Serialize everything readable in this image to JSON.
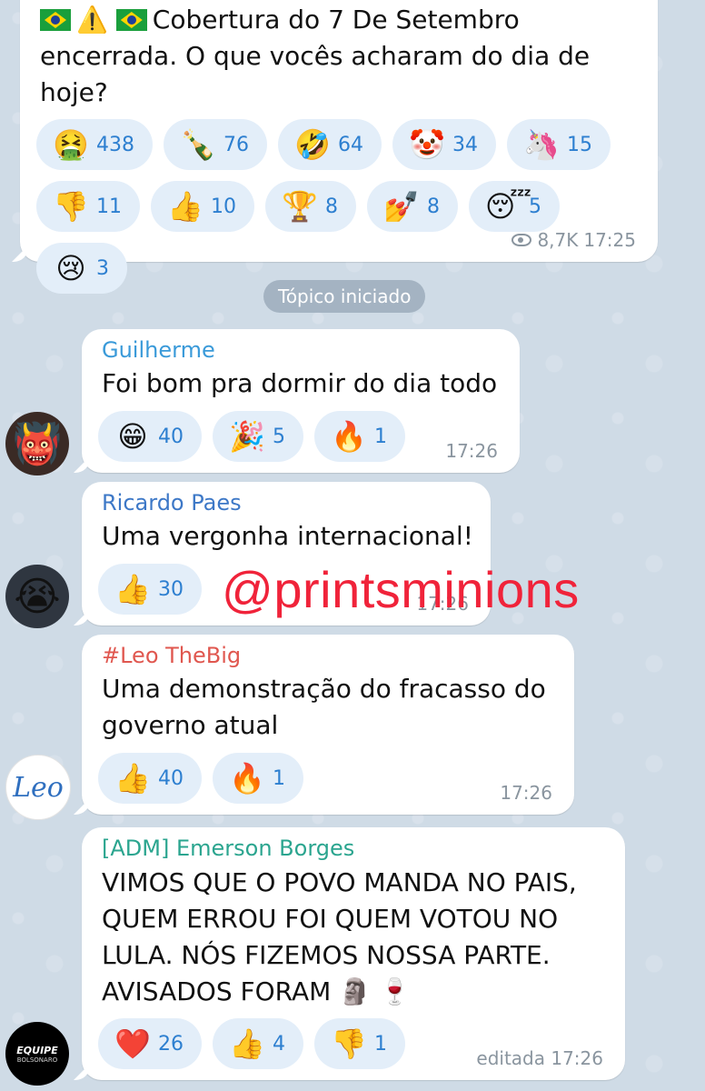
{
  "channel_post": {
    "flag1": "🇧🇷",
    "warning": "⚠️",
    "flag2": "🇧🇷",
    "text_line1": "Cobertura do 7 De Setembro",
    "text_line2": "encerrada. O que vocês acharam do dia de",
    "text_line3": "hoje?",
    "reactions": [
      {
        "emoji": "🤮",
        "count": "438"
      },
      {
        "emoji": "🍾",
        "count": "76"
      },
      {
        "emoji": "🤣",
        "count": "64"
      },
      {
        "emoji": "🤡",
        "count": "34"
      },
      {
        "emoji": "🦄",
        "count": "15"
      },
      {
        "emoji": "👎",
        "count": "11"
      },
      {
        "emoji": "👍",
        "count": "10"
      },
      {
        "emoji": "🏆",
        "count": "8"
      },
      {
        "emoji": "💅",
        "count": "8"
      },
      {
        "emoji": "😴",
        "count": "5"
      },
      {
        "emoji": "😢",
        "count": "3"
      }
    ],
    "views": "8,7K",
    "time": "17:25"
  },
  "service_message": "Tópico iniciado",
  "messages": [
    {
      "sender": "Guilherme",
      "sender_color": "#3a9ad9",
      "text": "Foi bom pra dormir do dia todo",
      "reactions": [
        {
          "emoji": "😁",
          "count": "40"
        },
        {
          "emoji": "🎉",
          "count": "5"
        },
        {
          "emoji": "🔥",
          "count": "1"
        }
      ],
      "time": "17:26",
      "avatar_emoji": "👹"
    },
    {
      "sender": "Ricardo Paes",
      "sender_color": "#3d78c7",
      "text": "Uma vergonha internacional!",
      "reactions": [
        {
          "emoji": "👍",
          "count": "30"
        }
      ],
      "time": "17:26",
      "avatar_emoji": "😭"
    },
    {
      "sender": "#Leo TheBig",
      "sender_color": "#e0574f",
      "text_line1": "Uma demonstração do fracasso do",
      "text_line2": "governo atual",
      "reactions": [
        {
          "emoji": "👍",
          "count": "40"
        },
        {
          "emoji": "🔥",
          "count": "1"
        }
      ],
      "time": "17:26",
      "avatar_text": "Leo"
    },
    {
      "sender": "[ADM] Emerson Borges",
      "sender_color": "#2ba58f",
      "text_line1": "VIMOS QUE O POVO MANDA NO PAIS,",
      "text_line2": "QUEM ERROU FOI QUEM VOTOU NO",
      "text_line3": "LULA. NÓS FIZEMOS NOSSA PARTE.",
      "text_line4": "AVISADOS FORAM",
      "text_emojis": "🗿 🍷",
      "reactions": [
        {
          "emoji": "❤️",
          "count": "26"
        },
        {
          "emoji": "👍",
          "count": "4"
        },
        {
          "emoji": "👎",
          "count": "1"
        }
      ],
      "time": "editada 17:26",
      "avatar_text_top": "EQUIPE",
      "avatar_text_bottom": "BOLSONARO"
    }
  ],
  "watermark": "@printsminions"
}
